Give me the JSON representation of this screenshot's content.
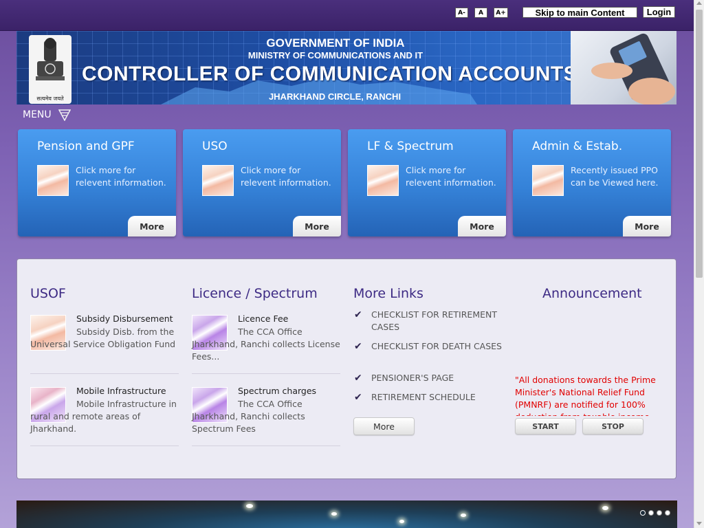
{
  "header": {
    "font_decrease": "A-",
    "font_normal": "A",
    "font_increase": "A+",
    "skip_link": "Skip to main Content",
    "login": "Login"
  },
  "banner": {
    "line1": "GOVERNMENT OF INDIA",
    "line2": "MINISTRY OF COMMUNICATIONS AND IT",
    "title": "CONTROLLER OF COMMUNICATION ACCOUNTS",
    "subtitle": "JHARKHAND CIRCLE, RANCHI",
    "emblem_text": "सत्यमेव जयते"
  },
  "menu": {
    "label": "MENU"
  },
  "tiles": [
    {
      "title": "Pension and GPF",
      "desc": "Click more for relevent information.",
      "more": "More"
    },
    {
      "title": "USO",
      "desc": "Click more for relevent information.",
      "more": "More"
    },
    {
      "title": "LF & Spectrum",
      "desc": "Click more for relevent information.",
      "more": "More"
    },
    {
      "title": "Admin & Estab.",
      "desc": "Recently issued PPO can be Viewed here.",
      "more": "More"
    }
  ],
  "usof": {
    "heading": "USOF",
    "items": [
      {
        "title": "Subsidy Disbursement",
        "text": "Subsidy Disb. from the Universal Service Obligation Fund"
      },
      {
        "title": "Mobile Infrastructure",
        "text": "Mobile Infrastructure in rural and remote areas of Jharkhand."
      }
    ]
  },
  "licence": {
    "heading": "Licence / Spectrum",
    "items": [
      {
        "title": "Licence Fee",
        "text": "The CCA Office Jharkhand, Ranchi collects License Fees..."
      },
      {
        "title": "Spectrum charges",
        "text": "The CCA Office Jharkhand, Ranchi collects Spectrum Fees"
      }
    ]
  },
  "more_links": {
    "heading": "More Links",
    "items": [
      "CHECKLIST FOR RETIREMENT CASES",
      "CHECKLIST FOR DEATH CASES",
      "PENSIONER'S PAGE",
      "RETIREMENT SCHEDULE"
    ],
    "more": "More"
  },
  "announcement": {
    "heading": "Announcement",
    "text": "\"All donations towards the Prime Minister's National Relief Fund (PMNRF) are notified for 100% deduction from taxable income",
    "start": "START",
    "stop": "STOP"
  },
  "slider": {
    "slides": 4,
    "active_slide": 1
  },
  "colors": {
    "accent_heading": "#3d2a84",
    "tile_blue": "#3582d8",
    "announcement_red": "#e10000",
    "page_purple": "#7e62b4"
  }
}
